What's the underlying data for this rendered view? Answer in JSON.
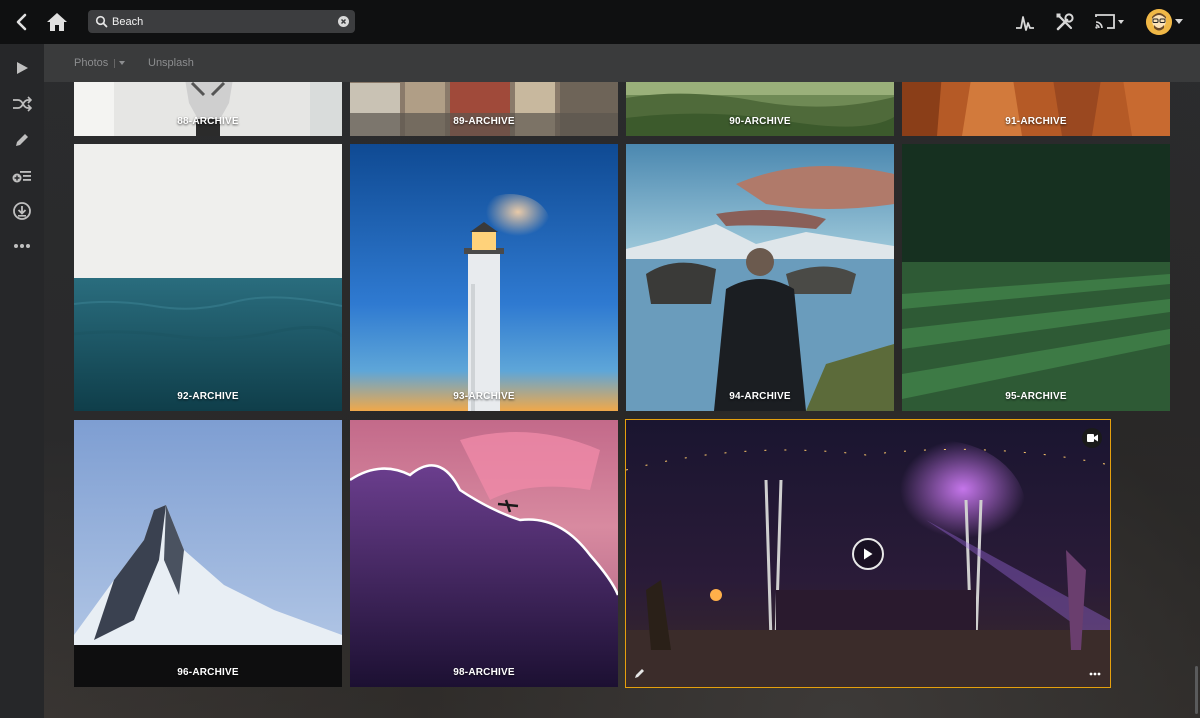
{
  "search": {
    "value": "Beach"
  },
  "subnav": {
    "library": "Photos",
    "collection": "Unsplash"
  },
  "tiles": {
    "t88": "88-ARCHIVE",
    "t89": "89-ARCHIVE",
    "t90": "90-ARCHIVE",
    "t91": "91-ARCHIVE",
    "t92": "92-ARCHIVE",
    "t93": "93-ARCHIVE",
    "t94": "94-ARCHIVE",
    "t95": "95-ARCHIVE",
    "t96": "96-ARCHIVE",
    "t98": "98-ARCHIVE"
  },
  "colors": {
    "accent": "#e5a00d",
    "topbar": "#0f1011",
    "sidebar": "#262729",
    "subbar": "#3a3b3c"
  },
  "icons": {
    "topbar": [
      "back-icon",
      "home-icon",
      "search-icon",
      "clear-icon",
      "activity-icon",
      "tools-icon",
      "cast-icon",
      "avatar"
    ],
    "sidebar": [
      "play-icon",
      "shuffle-icon",
      "edit-icon",
      "playlist-add-icon",
      "download-icon",
      "more-icon"
    ]
  }
}
